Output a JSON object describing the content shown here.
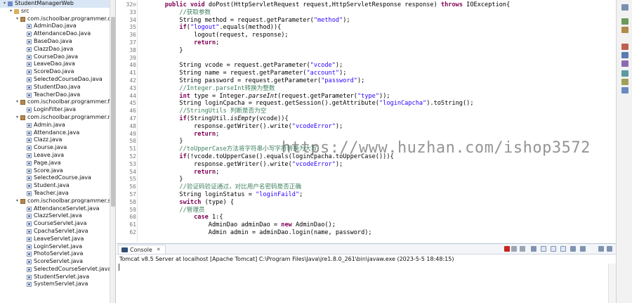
{
  "explorer": {
    "tree": [
      {
        "depth": 0,
        "kind": "project",
        "label": "StudentManagerWeb",
        "expanded": true
      },
      {
        "depth": 1,
        "kind": "folder",
        "label": "src",
        "expanded": true
      },
      {
        "depth": 2,
        "kind": "pkg",
        "label": "com.ischoolbar.programmer.dao",
        "expanded": true
      },
      {
        "depth": 3,
        "kind": "jfile",
        "label": "AdminDao.java"
      },
      {
        "depth": 3,
        "kind": "jfile",
        "label": "AttendanceDao.java"
      },
      {
        "depth": 3,
        "kind": "jfile",
        "label": "BaseDao.java"
      },
      {
        "depth": 3,
        "kind": "jfile",
        "label": "ClazzDao.java"
      },
      {
        "depth": 3,
        "kind": "jfile",
        "label": "CourseDao.java"
      },
      {
        "depth": 3,
        "kind": "jfile",
        "label": "LeaveDao.java"
      },
      {
        "depth": 3,
        "kind": "jfile",
        "label": "ScoreDao.java"
      },
      {
        "depth": 3,
        "kind": "jfile",
        "label": "SelectedCourseDao.java"
      },
      {
        "depth": 3,
        "kind": "jfile",
        "label": "StudentDao.java"
      },
      {
        "depth": 3,
        "kind": "jfile",
        "label": "TeacherDao.java"
      },
      {
        "depth": 2,
        "kind": "pkg",
        "label": "com.ischoolbar.programmer.filter",
        "expanded": true
      },
      {
        "depth": 3,
        "kind": "jfile",
        "label": "LoginFilter.java"
      },
      {
        "depth": 2,
        "kind": "pkg",
        "label": "com.ischoolbar.programmer.model",
        "expanded": true
      },
      {
        "depth": 3,
        "kind": "jfile",
        "label": "Admin.java"
      },
      {
        "depth": 3,
        "kind": "jfile",
        "label": "Attendance.java"
      },
      {
        "depth": 3,
        "kind": "jfile",
        "label": "Clazz.java"
      },
      {
        "depth": 3,
        "kind": "jfile",
        "label": "Course.java"
      },
      {
        "depth": 3,
        "kind": "jfile",
        "label": "Leave.java"
      },
      {
        "depth": 3,
        "kind": "jfile",
        "label": "Page.java"
      },
      {
        "depth": 3,
        "kind": "jfile",
        "label": "Score.java"
      },
      {
        "depth": 3,
        "kind": "jfile",
        "label": "SelectedCourse.java"
      },
      {
        "depth": 3,
        "kind": "jfile",
        "label": "Student.java"
      },
      {
        "depth": 3,
        "kind": "jfile",
        "label": "Teacher.java"
      },
      {
        "depth": 2,
        "kind": "pkg",
        "label": "com.ischoolbar.programmer.servlet",
        "expanded": true
      },
      {
        "depth": 3,
        "kind": "jfile",
        "label": "AttendanceServlet.java"
      },
      {
        "depth": 3,
        "kind": "jfile",
        "label": "ClazzServlet.java"
      },
      {
        "depth": 3,
        "kind": "jfile",
        "label": "CourseServlet.java"
      },
      {
        "depth": 3,
        "kind": "jfile",
        "label": "CpachaServlet.java"
      },
      {
        "depth": 3,
        "kind": "jfile",
        "label": "LeaveServlet.java"
      },
      {
        "depth": 3,
        "kind": "jfile",
        "label": "LoginServlet.java"
      },
      {
        "depth": 3,
        "kind": "jfile",
        "label": "PhotoServlet.java"
      },
      {
        "depth": 3,
        "kind": "jfile",
        "label": "ScoreServlet.java"
      },
      {
        "depth": 3,
        "kind": "jfile",
        "label": "SelectedCourseServlet.java"
      },
      {
        "depth": 3,
        "kind": "jfile",
        "label": "StudentServlet.java"
      },
      {
        "depth": 3,
        "kind": "jfile",
        "label": "SystemServlet.java"
      }
    ]
  },
  "editor": {
    "watermark": "https://www.huzhan.com/ishop3572",
    "lines": [
      {
        "n": "32⊖",
        "tokens": [
          [
            "",
            "    "
          ],
          [
            "kw",
            "public"
          ],
          [
            "",
            " "
          ],
          [
            "kw",
            "void"
          ],
          [
            "",
            " doPost(HttpServletRequest request,HttpServletResponse response) "
          ],
          [
            "kw",
            "throws"
          ],
          [
            "",
            " IOException{"
          ]
        ]
      },
      {
        "n": "33",
        "tokens": [
          [
            "",
            "        "
          ],
          [
            "cm",
            "//获取参数"
          ]
        ]
      },
      {
        "n": "34",
        "tokens": [
          [
            "",
            "        String method = request.getParameter("
          ],
          [
            "str",
            "\"method\""
          ],
          [
            "",
            ");"
          ]
        ]
      },
      {
        "n": "35",
        "tokens": [
          [
            "",
            "        "
          ],
          [
            "kw",
            "if"
          ],
          [
            "",
            "("
          ],
          [
            "str",
            "\"logout\""
          ],
          [
            "",
            ".equals(method)){"
          ]
        ]
      },
      {
        "n": "36",
        "tokens": [
          [
            "",
            "            logout(request, response);"
          ]
        ]
      },
      {
        "n": "37",
        "tokens": [
          [
            "",
            "            "
          ],
          [
            "kw",
            "return"
          ],
          [
            "",
            ";"
          ]
        ]
      },
      {
        "n": "38",
        "tokens": [
          [
            "",
            "        }"
          ]
        ]
      },
      {
        "n": "39",
        "tokens": []
      },
      {
        "n": "40",
        "tokens": [
          [
            "",
            "        String vcode = request.getParameter("
          ],
          [
            "str",
            "\"vcode\""
          ],
          [
            "",
            ");"
          ]
        ]
      },
      {
        "n": "41",
        "tokens": [
          [
            "",
            "        String name = request.getParameter("
          ],
          [
            "str",
            "\"account\""
          ],
          [
            "",
            ");"
          ]
        ]
      },
      {
        "n": "42",
        "tokens": [
          [
            "",
            "        String password = request.getParameter("
          ],
          [
            "str",
            "\"password\""
          ],
          [
            "",
            ");"
          ]
        ]
      },
      {
        "n": "43",
        "tokens": [
          [
            "",
            "        "
          ],
          [
            "cm",
            "//Integer.parseInt转换为整数"
          ]
        ]
      },
      {
        "n": "44",
        "tokens": [
          [
            "",
            "        "
          ],
          [
            "kw",
            "int"
          ],
          [
            "",
            " type = Integer."
          ],
          [
            "it",
            "parseInt"
          ],
          [
            "",
            "(request.getParameter("
          ],
          [
            "str",
            "\"type\""
          ],
          [
            "",
            "));"
          ]
        ]
      },
      {
        "n": "45",
        "tokens": [
          [
            "",
            "        String loginCpacha = request.getSession().getAttribute("
          ],
          [
            "str",
            "\"loginCapcha\""
          ],
          [
            "",
            ").toString();"
          ]
        ]
      },
      {
        "n": "46",
        "tokens": [
          [
            "",
            "        "
          ],
          [
            "cm",
            "//StringUtils 判断是否为空"
          ]
        ]
      },
      {
        "n": "47",
        "tokens": [
          [
            "",
            "        "
          ],
          [
            "kw",
            "if"
          ],
          [
            "",
            "(StringUtil."
          ],
          [
            "it",
            "isEmpty"
          ],
          [
            "",
            "(vcode)){"
          ]
        ]
      },
      {
        "n": "48",
        "tokens": [
          [
            "",
            "            response.getWriter().write("
          ],
          [
            "str",
            "\"vcodeError\""
          ],
          [
            "",
            ");"
          ]
        ]
      },
      {
        "n": "49",
        "tokens": [
          [
            "",
            "            "
          ],
          [
            "kw",
            "return"
          ],
          [
            "",
            ";"
          ]
        ]
      },
      {
        "n": "50",
        "tokens": [
          [
            "",
            "        }"
          ]
        ]
      },
      {
        "n": "51",
        "tokens": [
          [
            "",
            "        "
          ],
          [
            "cm",
            "//toUpperCase方法将字符串小写字符转换为大写"
          ]
        ]
      },
      {
        "n": "52",
        "tokens": [
          [
            "",
            "        "
          ],
          [
            "kw",
            "if"
          ],
          [
            "",
            "(!vcode.toUpperCase().equals(loginCpacha.toUpperCase())){"
          ]
        ]
      },
      {
        "n": "53",
        "tokens": [
          [
            "",
            "            response.getWriter().write("
          ],
          [
            "str",
            "\"vcodeError\""
          ],
          [
            "",
            ");"
          ]
        ]
      },
      {
        "n": "54",
        "tokens": [
          [
            "",
            "            "
          ],
          [
            "kw",
            "return"
          ],
          [
            "",
            ";"
          ]
        ]
      },
      {
        "n": "55",
        "tokens": [
          [
            "",
            "        }"
          ]
        ]
      },
      {
        "n": "56",
        "tokens": [
          [
            "",
            "        "
          ],
          [
            "cm",
            "//验证码验证通过，对比用户名密码是否正确"
          ]
        ]
      },
      {
        "n": "57",
        "tokens": [
          [
            "",
            "        String loginStatus = "
          ],
          [
            "str",
            "\"loginFaild\""
          ],
          [
            "",
            ";"
          ]
        ]
      },
      {
        "n": "58",
        "tokens": [
          [
            "",
            "        "
          ],
          [
            "kw",
            "switch"
          ],
          [
            "",
            " (type) {"
          ]
        ]
      },
      {
        "n": "59",
        "tokens": [
          [
            "",
            "        "
          ],
          [
            "cm",
            "//管理员"
          ]
        ]
      },
      {
        "n": "60",
        "tokens": [
          [
            "",
            "            "
          ],
          [
            "kw",
            "case"
          ],
          [
            "",
            " 1:{"
          ]
        ]
      },
      {
        "n": "61",
        "tokens": [
          [
            "",
            "                AdminDao adminDao = "
          ],
          [
            "kw",
            "new"
          ],
          [
            "",
            " AdminDao();"
          ]
        ]
      },
      {
        "n": "62",
        "tokens": [
          [
            "",
            "                Admin admin = adminDao.login(name, password);"
          ]
        ]
      }
    ]
  },
  "console": {
    "tab_label": "Console",
    "close_glyph": "✕",
    "description": "Tomcat v8.5 Server at localhost [Apache Tomcat] C:\\Program Files\\Java\\jre1.8.0_261\\bin\\javaw.exe  (2023-5-5 18:48:15)",
    "terminate_color": "#cc2222",
    "toolbar_icons": [
      "terminate-icon",
      "remove-launch-icon",
      "remove-all-icon",
      "clear-console-icon",
      "scroll-lock-icon",
      "word-wrap-icon",
      "pin-console-icon",
      "display-selected-icon",
      "open-console-icon",
      "minimize-icon",
      "maximize-icon"
    ]
  },
  "right_toolbar": {
    "icons": [
      "restore-icon",
      "outline-icon",
      "task-list-icon",
      "problems-icon",
      "javadoc-icon",
      "declaration-icon",
      "search-icon",
      "progress-icon",
      "servers-icon"
    ]
  },
  "colors": {
    "keyword": "#7f0055",
    "string": "#2a00ff",
    "comment": "#3f7f5f",
    "selection": "#d9e6f5"
  }
}
